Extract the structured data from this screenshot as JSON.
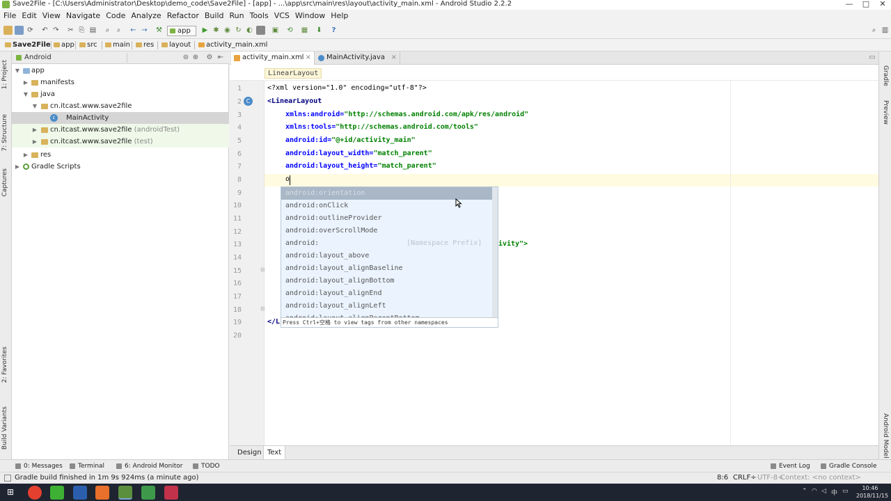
{
  "window": {
    "title": "Save2File - [C:\\Users\\Administrator\\Desktop\\demo_code\\Save2File] - [app] - ...\\app\\src\\main\\res\\layout\\activity_main.xml - Android Studio 2.2.2",
    "controls": [
      "—",
      "□",
      "✕"
    ]
  },
  "menu": [
    "File",
    "Edit",
    "View",
    "Navigate",
    "Code",
    "Analyze",
    "Refactor",
    "Build",
    "Run",
    "Tools",
    "VCS",
    "Window",
    "Help"
  ],
  "toolbar": {
    "run_config": "app"
  },
  "breadcrumbs": [
    "Save2File",
    "app",
    "src",
    "main",
    "res",
    "layout",
    "activity_main.xml"
  ],
  "left_strip": [
    "1: Project",
    "7: Structure",
    "Captures",
    "2: Favorites",
    "Build Variants"
  ],
  "right_strip": [
    "Gradle",
    "Preview",
    "Android Model"
  ],
  "project": {
    "view_mode": "Android",
    "tree": [
      {
        "label": "app",
        "suffix": ""
      },
      {
        "label": "manifests",
        "suffix": ""
      },
      {
        "label": "java",
        "suffix": ""
      },
      {
        "label": "cn.itcast.www.save2file",
        "suffix": ""
      },
      {
        "label": "MainActivity",
        "suffix": ""
      },
      {
        "label": "cn.itcast.www.save2file",
        "suffix": "(androidTest)"
      },
      {
        "label": "cn.itcast.www.save2file",
        "suffix": "(test)"
      },
      {
        "label": "res",
        "suffix": ""
      },
      {
        "label": "Gradle Scripts",
        "suffix": ""
      }
    ]
  },
  "editor_tabs": [
    {
      "label": "activity_main.xml",
      "active": true
    },
    {
      "label": "MainActivity.java",
      "active": false
    }
  ],
  "xml_breadcrumb": "LinearLayout",
  "line_numbers": [
    "1",
    "2",
    "3",
    "4",
    "5",
    "6",
    "7",
    "8",
    "9",
    "10",
    "11",
    "12",
    "13",
    "14",
    "15",
    "16",
    "17",
    "18",
    "19",
    "20"
  ],
  "code": {
    "l1": "<?xml version=\"1.0\" encoding=\"utf-8\"?>",
    "l2": "<LinearLayout",
    "l3_attr": "xmlns:android=",
    "l3_val": "\"http://schemas.android.com/apk/res/android\"",
    "l4_attr": "xmlns:tools=",
    "l4_val": "\"http://schemas.android.com/tools\"",
    "l5_attr": "android:id=",
    "l5_val": "\"@+id/activity_main\"",
    "l6_attr": "android:layout_width=",
    "l6_val": "\"match_parent\"",
    "l7_attr": "android:layout_height=",
    "l7_val": "\"match_parent\"",
    "l8": "o",
    "l13_tail": "ivity\">",
    "l19": "</L"
  },
  "completion": {
    "items": [
      "android:orientation",
      "android:onClick",
      "android:outlineProvider",
      "android:overScrollMode",
      "android:",
      "android:layout_above",
      "android:layout_alignBaseline",
      "android:layout_alignBottom",
      "android:layout_alignEnd",
      "android:layout_alignLeft",
      "android:layout_alignParentBottom"
    ],
    "namespace_hint": "[Namespace Prefix]",
    "footer": "Press Ctrl+空格 to view tags from other namespaces"
  },
  "design_tabs": [
    "Design",
    "Text"
  ],
  "bottom_tools": {
    "left": [
      "0: Messages",
      "Terminal",
      "6: Android Monitor",
      "TODO"
    ],
    "right": [
      "Event Log",
      "Gradle Console"
    ]
  },
  "status": {
    "message": "Gradle build finished in 1m 9s 924ms (a minute ago)",
    "position": "8:6",
    "line_sep": "CRLF÷",
    "encoding": "UTF-8÷",
    "context": "Context: <no context>"
  },
  "taskbar": {
    "time": "10:46",
    "date": "2018/11/15",
    "apps": [
      {
        "name": "chrome",
        "color": "#e4402f"
      },
      {
        "name": "wechat",
        "color": "#3eb034"
      },
      {
        "name": "word",
        "color": "#2b5fae"
      },
      {
        "name": "slides",
        "color": "#e8702a"
      },
      {
        "name": "android-studio",
        "color": "#5b8f3d"
      },
      {
        "name": "spreadsheet",
        "color": "#3e9a4a"
      },
      {
        "name": "tool",
        "color": "#c2324a"
      }
    ]
  }
}
